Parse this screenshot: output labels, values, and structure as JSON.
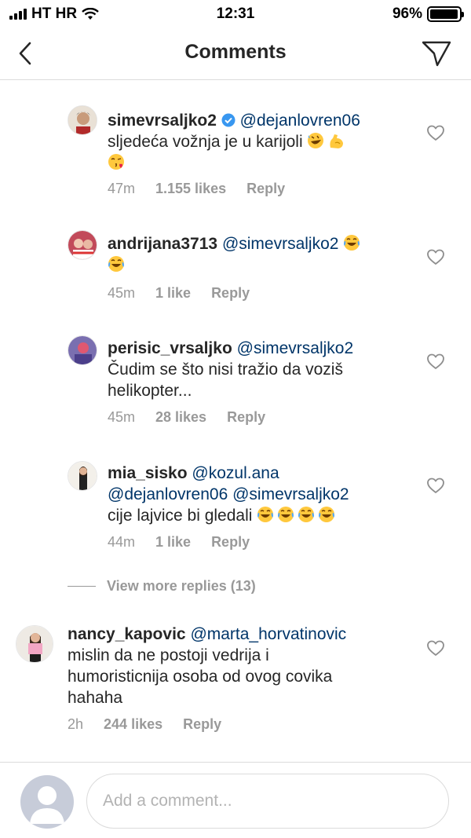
{
  "status_bar": {
    "carrier": "HT HR",
    "time": "12:31",
    "battery": "96%",
    "battery_level": 0.96
  },
  "header": {
    "title": "Comments"
  },
  "comments": [
    {
      "username": "simevrsaljko2",
      "verified": true,
      "mentions": "@dejanlovren06",
      "line1": "sljedeća vožnja  je u karijoli",
      "line1_emojis": [
        "rolling-on-floor-laughing-emoji",
        "flexed-biceps-emoji"
      ],
      "line2_emojis": [
        "face-blowing-kiss-emoji"
      ],
      "time": "47m",
      "likes": "1.155 likes",
      "reply": "Reply"
    },
    {
      "username": "andrijana3713",
      "mentions": "@simevrsaljko2",
      "mention_emojis": [
        "tears-of-joy-emoji"
      ],
      "line2_emojis": [
        "tears-of-joy-emoji"
      ],
      "time": "45m",
      "likes": "1 like",
      "reply": "Reply"
    },
    {
      "username": "perisic_vrsaljko",
      "mentions": "@simevrsaljko2",
      "line1": "Čudim se što nisi tražio da voziš",
      "line2": "helikopter...",
      "time": "45m",
      "likes": "28 likes",
      "reply": "Reply"
    },
    {
      "username": "mia_sisko",
      "mentions": "@kozul.ana",
      "mentions_line2": "@dejanlovren06  @simevrsaljko2",
      "line3": "cije lajvice bi gledali",
      "line3_emojis": [
        "tears-of-joy-emoji",
        "tears-of-joy-emoji",
        "tears-of-joy-emoji",
        "tears-of-joy-emoji"
      ],
      "time": "44m",
      "likes": "1 like",
      "reply": "Reply"
    },
    {
      "username": "nancy_kapovic",
      "mentions": "@marta_horvatinovic",
      "line1": "mislin da ne postoji vedrija i",
      "line2": "humoristicnija osoba od ovog covika",
      "line3": "hahaha",
      "time": "2h",
      "likes": "244 likes",
      "reply": "Reply"
    }
  ],
  "view_more": "View more replies (13)",
  "composer": {
    "placeholder": "Add a comment..."
  },
  "colors": {
    "mention": "#003569",
    "meta": "#999999",
    "divider": "#dbdbdb",
    "text": "#262626"
  }
}
